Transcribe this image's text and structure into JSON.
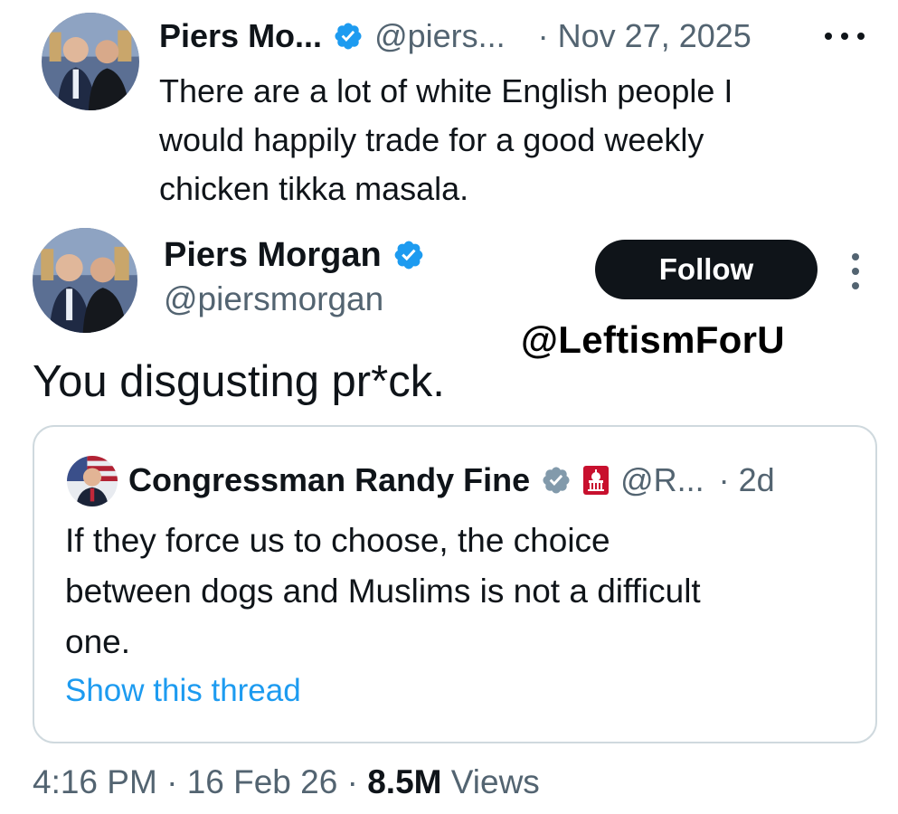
{
  "colors": {
    "text_primary": "#0f1419",
    "text_secondary": "#536471",
    "link_blue": "#1d9bf0",
    "verified_blue": "#1d9bf0",
    "verified_gray": "#829aab",
    "follow_bg": "#0f1419",
    "border": "#cfd9de"
  },
  "quoted_top": {
    "display_name": "Piers Mo...",
    "handle": "@piers...",
    "date": "· Nov 27, 2025",
    "text": "There are a lot of white English people I\nwould happily trade for a good weekly\nchicken tikka masala.",
    "verified_icon": "verified-badge-blue",
    "more_icon": "more-horizontal-icon"
  },
  "tweet": {
    "display_name": "Piers Morgan",
    "handle": "@piersmorgan",
    "follow_label": "Follow",
    "text": "You disgusting pr*ck.",
    "verified_icon": "verified-badge-blue",
    "more_icon": "more-vertical-icon"
  },
  "watermark": "@LeftismForU",
  "quote": {
    "display_name": "Congressman Randy Fine",
    "handle": "@R...",
    "time": "· 2d",
    "verified_icon": "verified-badge-gray",
    "affiliate_icon": "capitol-badge-icon",
    "text": "If they force us to choose, the choice\nbetween dogs and Muslims is not a difficult\none.",
    "show_thread": "Show this thread"
  },
  "meta": {
    "time": "4:16 PM",
    "date": "16 Feb 26",
    "views_count": "8.5M",
    "views_label": "Views",
    "separator": "·"
  }
}
